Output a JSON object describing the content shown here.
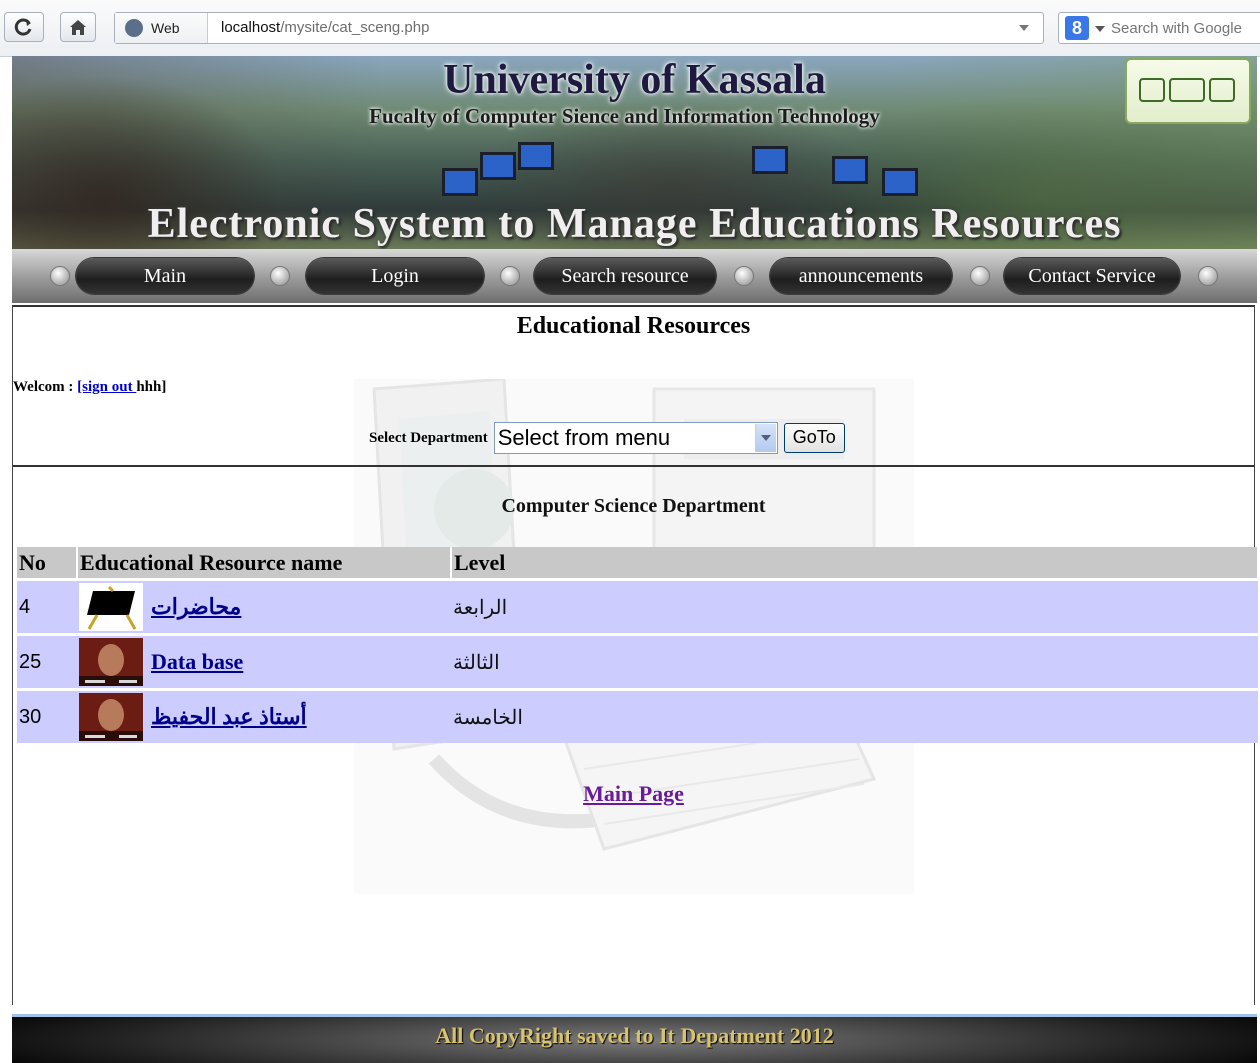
{
  "browser": {
    "identity_label": "Web",
    "url_host": "localhost",
    "url_path": "/mysite/cat_sceng.php",
    "search_placeholder": "Search with Google"
  },
  "banner": {
    "university": "University of Kassala",
    "faculty": "Fucalty of Computer Sience and Information Technology",
    "system_name": "Electronic System to Manage Educations Resources"
  },
  "nav": {
    "items": [
      "Main",
      "Login",
      "Search resource",
      "announcements",
      "Contact Service"
    ]
  },
  "page": {
    "title": "Educational Resources",
    "welcome_prefix": "Welcom : ",
    "sign_out": "[sign out ",
    "username": "hhh]",
    "select_label": "Select Department",
    "select_value": "Select from menu",
    "goto_label": "GoTo",
    "department": "Computer Science Department",
    "main_page_link": "Main Page"
  },
  "table": {
    "headers": [
      "No",
      "Educational Resource name",
      "Level"
    ],
    "rows": [
      {
        "no": "4",
        "name": "محاضرات",
        "level": "الرابعة",
        "thumb": "blackboard-icon"
      },
      {
        "no": "25",
        "name": "Data base",
        "level": "الثالثة",
        "thumb": "portrait-thumbnail"
      },
      {
        "no": "30",
        "name": "أستاذ عبد الحفيظ",
        "level": "الخامسة",
        "thumb": "portrait-thumbnail"
      }
    ]
  },
  "footer": {
    "text": "All CopyRight saved to It Depatment 2012"
  }
}
